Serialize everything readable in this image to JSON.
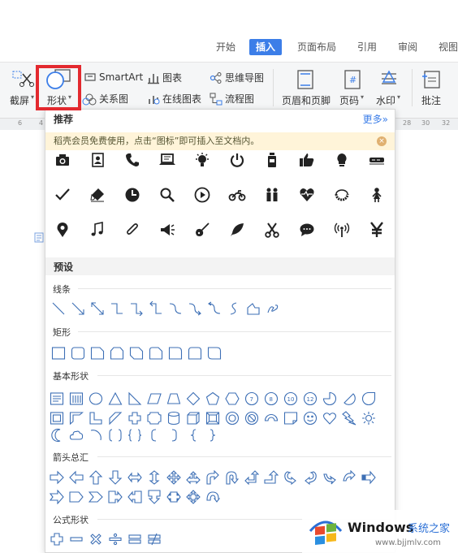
{
  "tabs": [
    {
      "label": "开始",
      "active": false
    },
    {
      "label": "插入",
      "active": true
    },
    {
      "label": "页面布局",
      "active": false
    },
    {
      "label": "引用",
      "active": false
    },
    {
      "label": "审阅",
      "active": false
    },
    {
      "label": "视图",
      "active": false
    }
  ],
  "ribbon": {
    "screenshot": "截屏",
    "shapes": "形状",
    "smartart": "SmartArt",
    "chart": "图表",
    "mindmap": "思维导图",
    "relation": "关系图",
    "online_chart": "在线图表",
    "flowchart": "流程图",
    "header_footer": "页眉和页脚",
    "page_number": "页码",
    "watermark": "水印",
    "comment": "批注"
  },
  "ruler": [
    "6",
    "4",
    "28",
    "30",
    "32"
  ],
  "popup": {
    "title": "推荐",
    "more": "更多»",
    "banner": "稻壳会员免费使用，点击“图标”即可插入至文档内。",
    "preset": "预设",
    "categories": {
      "lines": "线条",
      "rectangles": "矩形",
      "basic": "基本形状",
      "arrows": "箭头总汇",
      "equation": "公式形状"
    }
  },
  "watermark": {
    "brand": "Windows",
    "sub": "系统之家",
    "url": "www.bjjmlv.com"
  },
  "colors": {
    "accent": "#3c7ee8",
    "highlight": "#e3292f",
    "banner": "#fff4d9",
    "shape_stroke": "#3d6fb5"
  }
}
